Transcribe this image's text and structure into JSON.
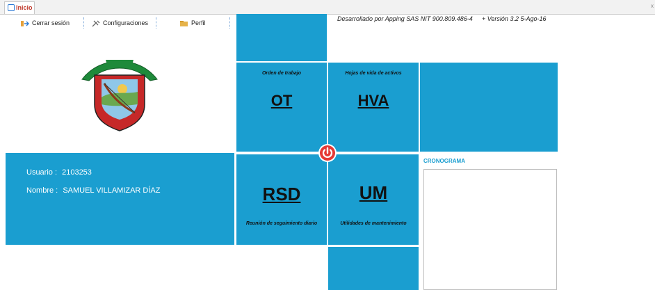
{
  "tab": {
    "title": "Inicio",
    "close_glyph": "x"
  },
  "menu": {
    "logout": {
      "label": "Cerrar sesión",
      "icon": "logout-icon"
    },
    "settings": {
      "label": "Configuraciones",
      "icon": "tools-icon"
    },
    "profile": {
      "label": "Perfil",
      "icon": "folder-icon"
    }
  },
  "developer": "Desarrollado por Apping SAS NIT 900.809.486-4",
  "version": "+ Versión 3.2  5-Ago-16",
  "tiles": {
    "ot": {
      "caption": "Orden de trabajo",
      "code": "OT"
    },
    "hva": {
      "caption": "Hojas de vida de activos",
      "code": "HVA"
    },
    "rsd": {
      "caption": "Reunión de seguimiento diario",
      "code": "RSD"
    },
    "um": {
      "caption": "Utilidades de mantenimiento",
      "code": "UM"
    }
  },
  "user": {
    "usuario_label": "Usuario  :",
    "usuario_value": "2103253",
    "nombre_label": "Nombre  :",
    "nombre_value": "SAMUEL VILLAMIZAR DÍAZ"
  },
  "cronograma": {
    "title": "CRONOGRAMA"
  },
  "colors": {
    "tile": "#1a9ed0",
    "power": "#e53935",
    "tab_text": "#c0392b"
  }
}
